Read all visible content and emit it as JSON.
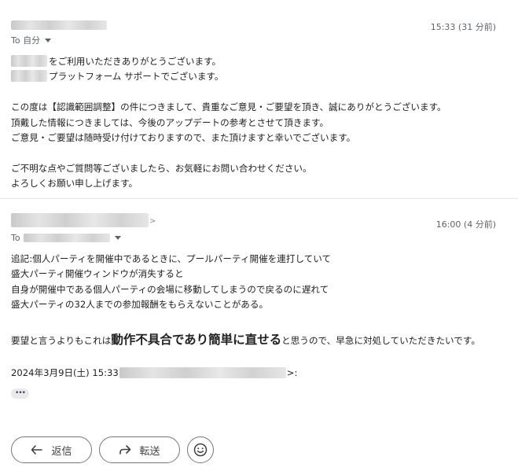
{
  "message1": {
    "time": "15:33 (31 分前)",
    "to_label": "To 自分",
    "greeting_line1": "をご利用いただきありがとうございます。",
    "greeting_line2": "プラットフォーム サポートでございます。",
    "para1_line1": "この度は【認識範囲調整】の件につきまして、貴重なご意見・ご要望を頂き、誠にありがとうございます。",
    "para1_line2": "頂戴した情報につきましては、今後のアップデートの参考とさせて頂きます。",
    "para1_line3": "ご意見・ご要望は随時受け付けておりますので、また頂けますと幸いでございます。",
    "para2_line1": "ご不明な点やご質問等ございましたら、お気軽にお問い合わせください。",
    "para2_line2": "よろしくお願い申し上げます。"
  },
  "message2": {
    "time": "16:00 (4 分前)",
    "to_label": "To",
    "sender_arrow": ">",
    "body_line1": "追記:個人パーティを開催中であるときに、プールパーティ開催を連打していて",
    "body_line2": "盛大パーティ開催ウィンドウが消失すると",
    "body_line3": "自身が開催中である個人パーティの会場に移動してしまうので戻るのに遅れて",
    "body_line4": "盛大パーティの32人までの参加報酬をもらえないことがある。",
    "emph_prefix": "要望と言うよりもこれは",
    "emph_big": "動作不具合であり簡単に直せる",
    "emph_suffix": "と思うので、早急に対処していただきたいです。",
    "quote_prefix": "2024年3月9日(土) 15:33",
    "quote_suffix": ">:",
    "ellipsis": "•••"
  },
  "actions": {
    "reply_label": "返信",
    "forward_label": "転送"
  },
  "icons": {
    "reply": "reply-icon",
    "forward": "forward-icon",
    "emoji": "emoji-icon",
    "dropdown": "chevron-down-icon"
  }
}
